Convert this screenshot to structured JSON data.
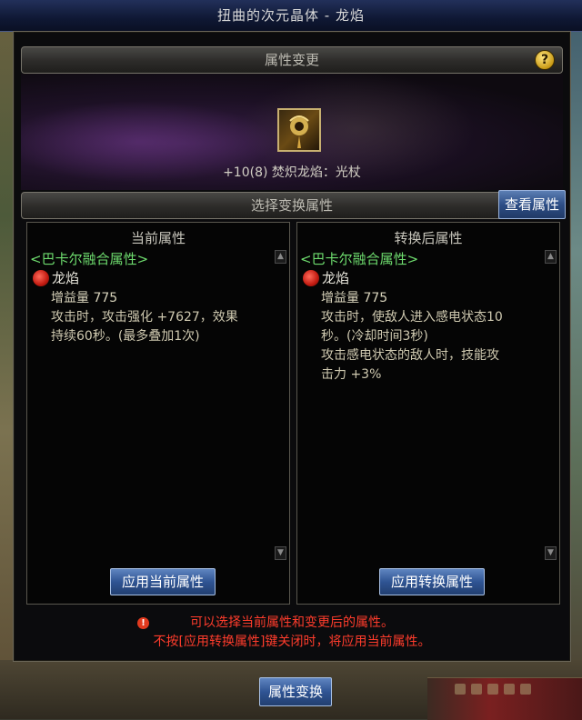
{
  "window": {
    "title": "扭曲的次元晶体 - 龙焰"
  },
  "header": {
    "title": "属性变更",
    "help_label": "?"
  },
  "item": {
    "icon": "staff-item-icon",
    "name": "+10(8) 焚炽龙焰：光杖"
  },
  "section": {
    "title": "选择变换属性",
    "view_button": "查看属性"
  },
  "current": {
    "title": "当前属性",
    "group": "<巴卡尔融合属性>",
    "skill": "龙焰",
    "lines": [
      "增益量 775",
      "攻击时，攻击强化 +7627，效果",
      "持续60秒。(最多叠加1次)"
    ],
    "apply_button": "应用当前属性"
  },
  "converted": {
    "title": "转换后属性",
    "group": "<巴卡尔融合属性>",
    "skill": "龙焰",
    "lines": [
      "增益量 775",
      "攻击时，使敌人进入感电状态10",
      "秒。(冷却时间3秒)",
      "攻击感电状态的敌人时，技能攻",
      "击力 +3%"
    ],
    "apply_button": "应用转换属性"
  },
  "notice": {
    "line1": "可以选择当前属性和变更后的属性。",
    "line2": "不按[应用转换属性]键关闭时，将应用当前属性。",
    "icon": "!"
  },
  "footer": {
    "transform_button": "属性变换"
  }
}
